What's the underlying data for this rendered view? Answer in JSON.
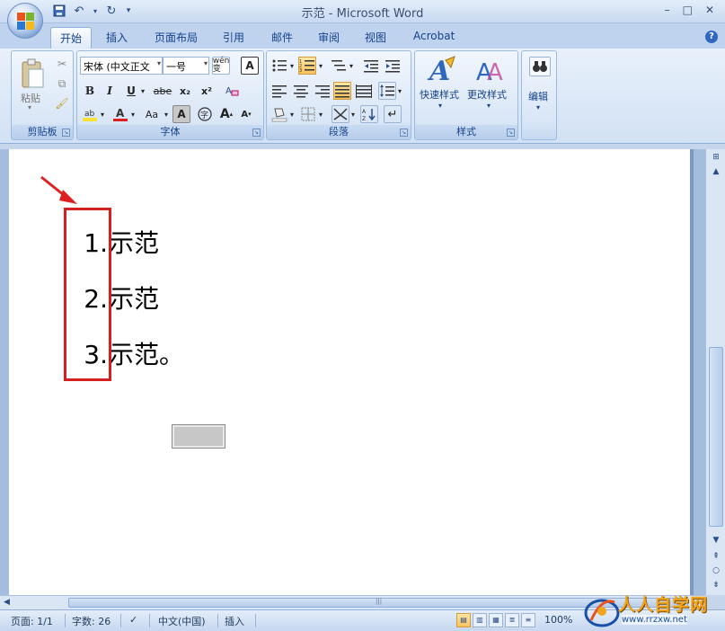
{
  "window": {
    "title": "示范 - Microsoft Word",
    "minimize": "–",
    "maximize": "□",
    "close": "✕"
  },
  "tabs": [
    {
      "label": "开始",
      "active": true
    },
    {
      "label": "插入"
    },
    {
      "label": "页面布局"
    },
    {
      "label": "引用"
    },
    {
      "label": "邮件"
    },
    {
      "label": "审阅"
    },
    {
      "label": "视图"
    },
    {
      "label": "Acrobat"
    }
  ],
  "ribbon": {
    "clipboard": {
      "label": "剪贴板",
      "paste_label": "粘贴"
    },
    "font": {
      "label": "字体",
      "font_name": "宋体 (中文正文",
      "font_size": "一号",
      "wen_label": "wén\n变",
      "bold": "B",
      "italic": "I",
      "underline": "U",
      "strike": "abe",
      "subscript": "x₂",
      "superscript": "x²",
      "grow": "A",
      "shrink": "A",
      "case": "Aa",
      "font_color_label": "A",
      "char_border": "A",
      "char_shade": "A"
    },
    "paragraph": {
      "label": "段落"
    },
    "styles": {
      "label": "样式",
      "quick_styles": "快速样式",
      "change_styles": "更改样式"
    },
    "editing": {
      "label": "编辑"
    }
  },
  "document": {
    "list": [
      {
        "number": "1.",
        "text": "示范"
      },
      {
        "number": "2.",
        "text": "示范"
      },
      {
        "number": "3.",
        "text": "示范。"
      }
    ]
  },
  "statusbar": {
    "page": "页面: 1/1",
    "words": "字数: 26",
    "language": "中文(中国)",
    "mode": "插入",
    "zoom": "100%"
  },
  "watermark": {
    "title": "人人自学网",
    "url": "www.rrzxw.net"
  },
  "colors": {
    "annotation_red": "#d52020",
    "highlight_yellow": "#f9e33a",
    "font_red": "#e02020",
    "ribbon_blue": "#15428b"
  }
}
